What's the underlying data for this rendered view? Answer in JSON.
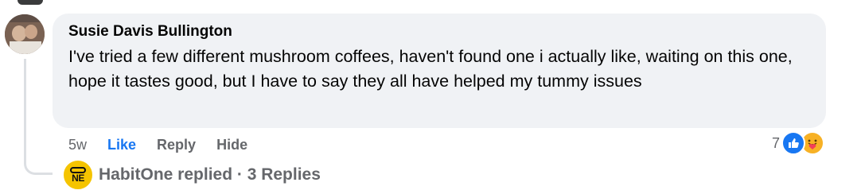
{
  "comment": {
    "author": "Susie Davis Bullington",
    "text": "I've tried a few different mushroom coffees, haven't found one i actually like, waiting on this one, hope it tastes good, but I have to say they all have helped my tummy issues",
    "time": "5w",
    "actions": {
      "like": "Like",
      "reply": "Reply",
      "hide": "Hide"
    },
    "reactions": {
      "count": "7",
      "types": [
        "like-icon",
        "care-icon"
      ]
    }
  },
  "replies": {
    "summary": "HabitOne replied · 3 Replies",
    "logo_text": "NE"
  },
  "colors": {
    "bubble": "#f0f2f5",
    "like_blue": "#1877f2",
    "muted": "#65676b",
    "brand_yellow": "#f5c400"
  }
}
